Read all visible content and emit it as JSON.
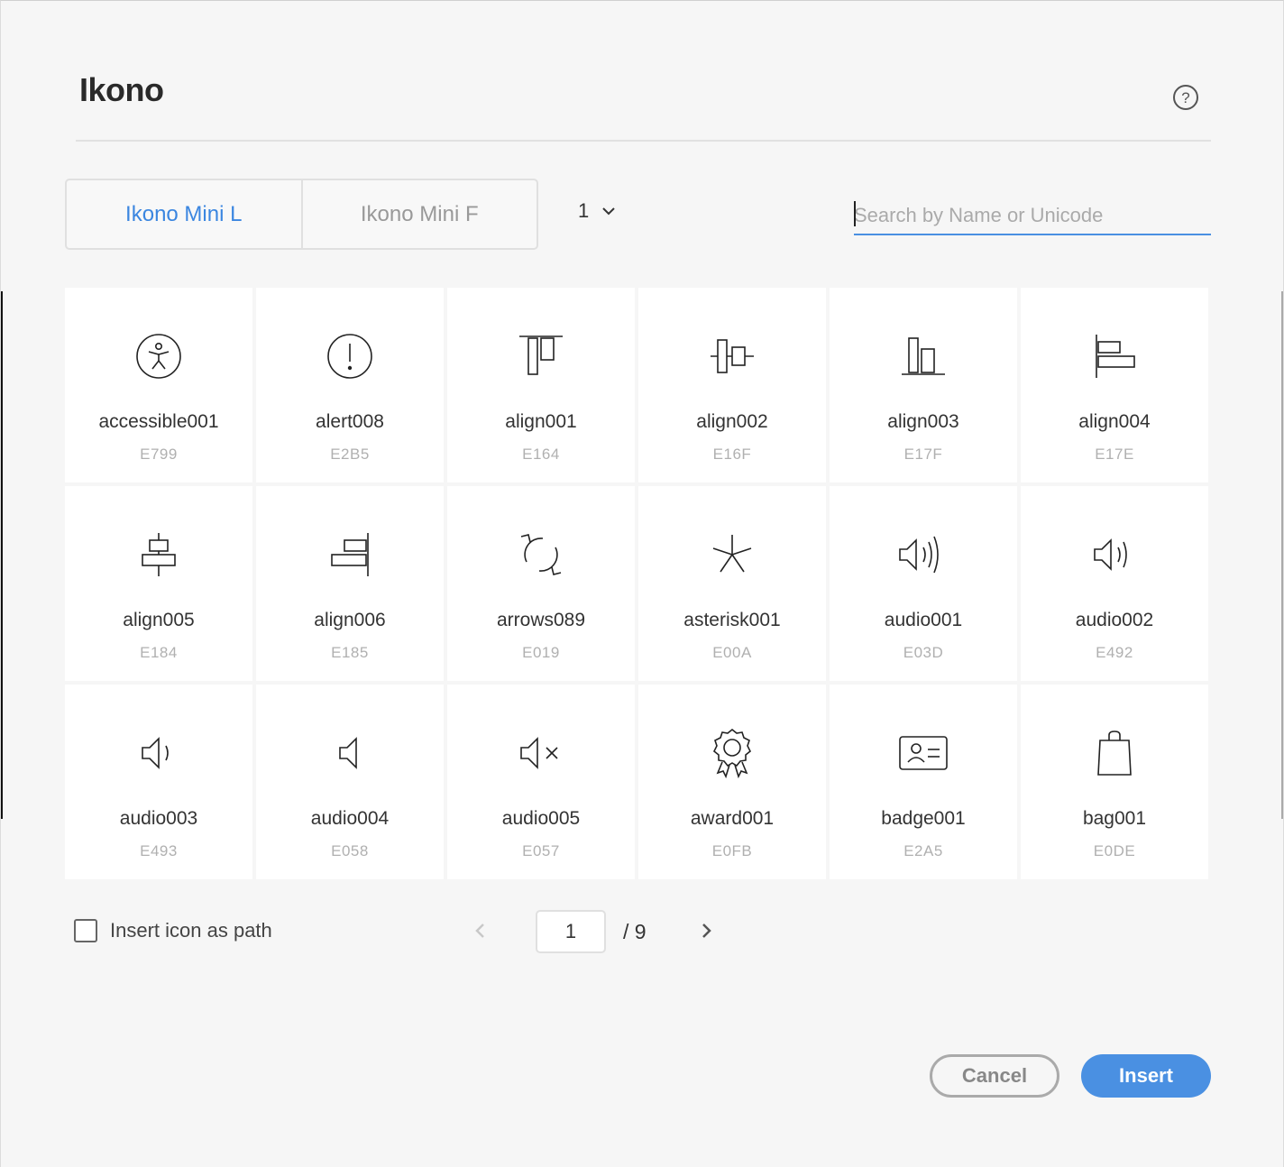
{
  "dialog": {
    "title": "Ikono",
    "help_icon": "help-circle-icon"
  },
  "tabs": [
    {
      "label": "Ikono Mini L",
      "active": true
    },
    {
      "label": "Ikono Mini F",
      "active": false
    }
  ],
  "weight": {
    "value": "1"
  },
  "search": {
    "placeholder": "Search by Name or Unicode",
    "value": ""
  },
  "icons": [
    {
      "name": "accessible001",
      "code": "E799",
      "icon": "accessible-icon"
    },
    {
      "name": "alert008",
      "code": "E2B5",
      "icon": "alert-icon"
    },
    {
      "name": "align001",
      "code": "E164",
      "icon": "align-top-icon"
    },
    {
      "name": "align002",
      "code": "E16F",
      "icon": "align-center-vertical-icon"
    },
    {
      "name": "align003",
      "code": "E17F",
      "icon": "align-bottom-icon"
    },
    {
      "name": "align004",
      "code": "E17E",
      "icon": "align-left-icon"
    },
    {
      "name": "align005",
      "code": "E184",
      "icon": "align-center-horizontal-icon"
    },
    {
      "name": "align006",
      "code": "E185",
      "icon": "align-right-icon"
    },
    {
      "name": "arrows089",
      "code": "E019",
      "icon": "refresh-arrows-icon"
    },
    {
      "name": "asterisk001",
      "code": "E00A",
      "icon": "asterisk-icon"
    },
    {
      "name": "audio001",
      "code": "E03D",
      "icon": "speaker-loud-icon"
    },
    {
      "name": "audio002",
      "code": "E492",
      "icon": "speaker-medium-icon"
    },
    {
      "name": "audio003",
      "code": "E493",
      "icon": "speaker-low-icon"
    },
    {
      "name": "audio004",
      "code": "E058",
      "icon": "speaker-icon"
    },
    {
      "name": "audio005",
      "code": "E057",
      "icon": "speaker-mute-icon"
    },
    {
      "name": "award001",
      "code": "E0FB",
      "icon": "award-icon"
    },
    {
      "name": "badge001",
      "code": "E2A5",
      "icon": "id-badge-icon"
    },
    {
      "name": "bag001",
      "code": "E0DE",
      "icon": "shopping-bag-icon"
    }
  ],
  "options": {
    "insert_as_path_label": "Insert icon as path",
    "insert_as_path_checked": false
  },
  "pager": {
    "current": "1",
    "total": "/ 9"
  },
  "buttons": {
    "cancel": "Cancel",
    "insert": "Insert"
  }
}
